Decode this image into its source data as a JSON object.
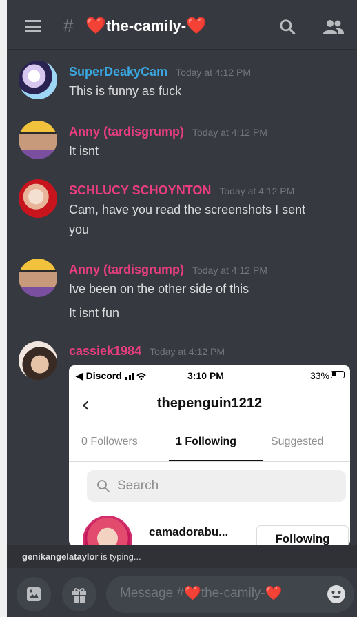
{
  "header": {
    "channel_prefix": "the-camily-",
    "heart": "❤️"
  },
  "messages": [
    {
      "username": "SuperDeakyCam",
      "color": "#3ba7e0",
      "timestamp": "Today at 4:12 PM",
      "lines": [
        "This is funny as fuck"
      ]
    },
    {
      "username": "Anny  (tardisgrump)",
      "color": "#e93d82",
      "timestamp": "Today at 4:12 PM",
      "lines": [
        "It isnt"
      ]
    },
    {
      "username": "SCHLUCY SCHOYNTON",
      "color": "#e93d82",
      "timestamp": "Today at 4:12 PM",
      "lines": [
        "Cam, have you read the screenshots I sent",
        "you"
      ]
    },
    {
      "username": "Anny  (tardisgrump)",
      "color": "#e93d82",
      "timestamp": "Today at 4:12 PM",
      "lines": [
        "Ive been on the other side of this",
        "It isnt fun"
      ]
    },
    {
      "username": "cassiek1984",
      "color": "#e93d82",
      "timestamp": "Today at 4:12 PM",
      "lines": []
    }
  ],
  "attachment": {
    "status_left": "◀ Discord",
    "status_time": "3:10 PM",
    "status_battery": "33%",
    "profile_username": "thepenguin1212",
    "tabs": [
      "0 Followers",
      "1 Following",
      "Suggested"
    ],
    "active_tab": "1 Following",
    "search_placeholder": "Search",
    "row_username": "camadorabu...",
    "row_button": "Following"
  },
  "typing": {
    "user": "genikangelataylor",
    "suffix": " is typing..."
  },
  "composer": {
    "placeholder_prefix": "Message #",
    "placeholder_channel": "the-camily-"
  }
}
